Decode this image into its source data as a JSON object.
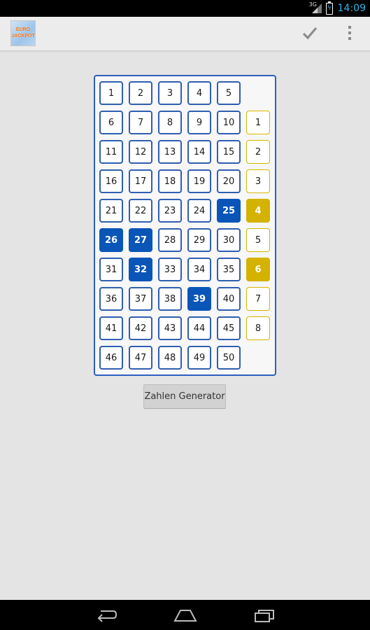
{
  "status": {
    "network": "3G",
    "time": "14:09"
  },
  "app": {
    "logo_line1": "EURO",
    "logo_line2": "JACKPOT"
  },
  "actions": {
    "confirm_icon": "check-icon",
    "overflow_icon": "overflow-menu-icon"
  },
  "board": {
    "numbers": [
      "1",
      "2",
      "3",
      "4",
      "5",
      "6",
      "7",
      "8",
      "9",
      "10",
      "11",
      "12",
      "13",
      "14",
      "15",
      "16",
      "17",
      "18",
      "19",
      "20",
      "21",
      "22",
      "23",
      "24",
      "25",
      "26",
      "27",
      "28",
      "29",
      "30",
      "31",
      "32",
      "33",
      "34",
      "35",
      "36",
      "37",
      "38",
      "39",
      "40",
      "41",
      "42",
      "43",
      "44",
      "45",
      "46",
      "47",
      "48",
      "49",
      "50"
    ],
    "selected_numbers": [
      25,
      26,
      27,
      32,
      39
    ],
    "stars": [
      "1",
      "2",
      "3",
      "4",
      "5",
      "6",
      "7",
      "8"
    ],
    "selected_stars": [
      4,
      6
    ],
    "colors": {
      "number_border": "#2f5fb0",
      "number_selected": "#0a56b8",
      "star_border": "#d8b400",
      "star_selected": "#d4b200"
    }
  },
  "generator_button": "Zahlen Generator",
  "nav": {
    "back_icon": "back-icon",
    "home_icon": "home-icon",
    "recents_icon": "recent-apps-icon"
  }
}
